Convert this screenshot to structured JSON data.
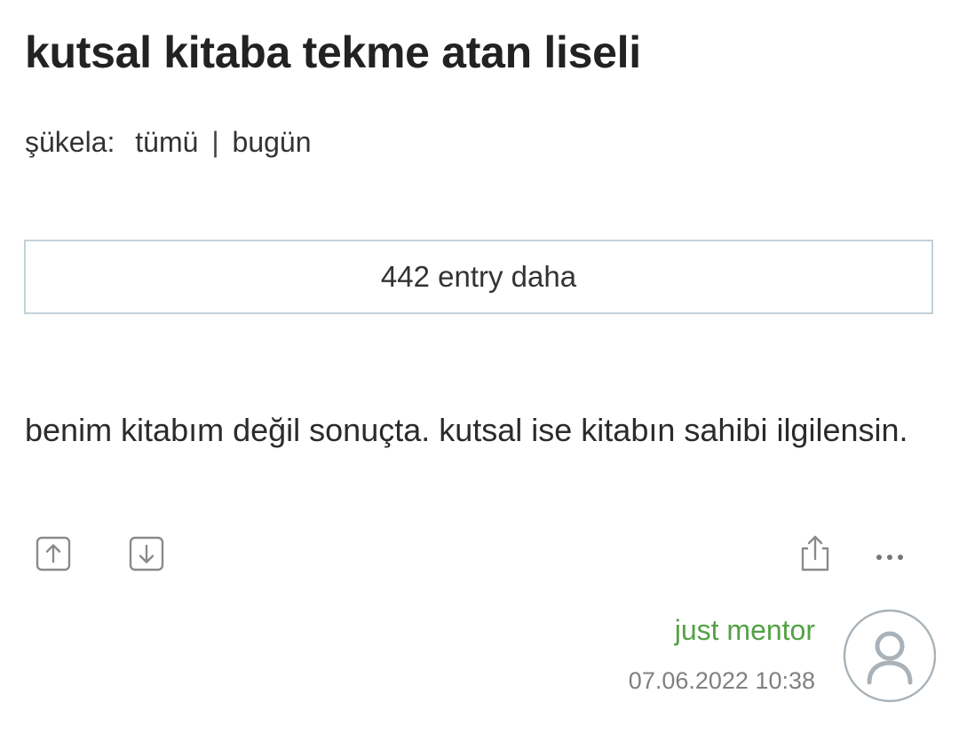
{
  "topic": {
    "title": "kutsal kitaba tekme atan liseli"
  },
  "filter": {
    "label": "şükela:",
    "option_all": "tümü",
    "separator": "|",
    "option_today": "bugün"
  },
  "more_entries": {
    "label": "442 entry daha"
  },
  "entry": {
    "text": "benim kitabım değil sonuçta. kutsal ise kitabın sahibi ilgilensin.",
    "author": "just mentor",
    "date": "07.06.2022 10:38"
  },
  "actions": {
    "more_label": "•••"
  },
  "icons": {
    "vote_up": "arrow-up-box-icon",
    "vote_down": "arrow-down-box-icon",
    "share": "share-icon",
    "more": "ellipsis-icon",
    "avatar": "user-avatar-icon"
  },
  "colors": {
    "author": "#53a245",
    "button_border": "#c3d1d9",
    "icon": "#8a8a8a"
  }
}
